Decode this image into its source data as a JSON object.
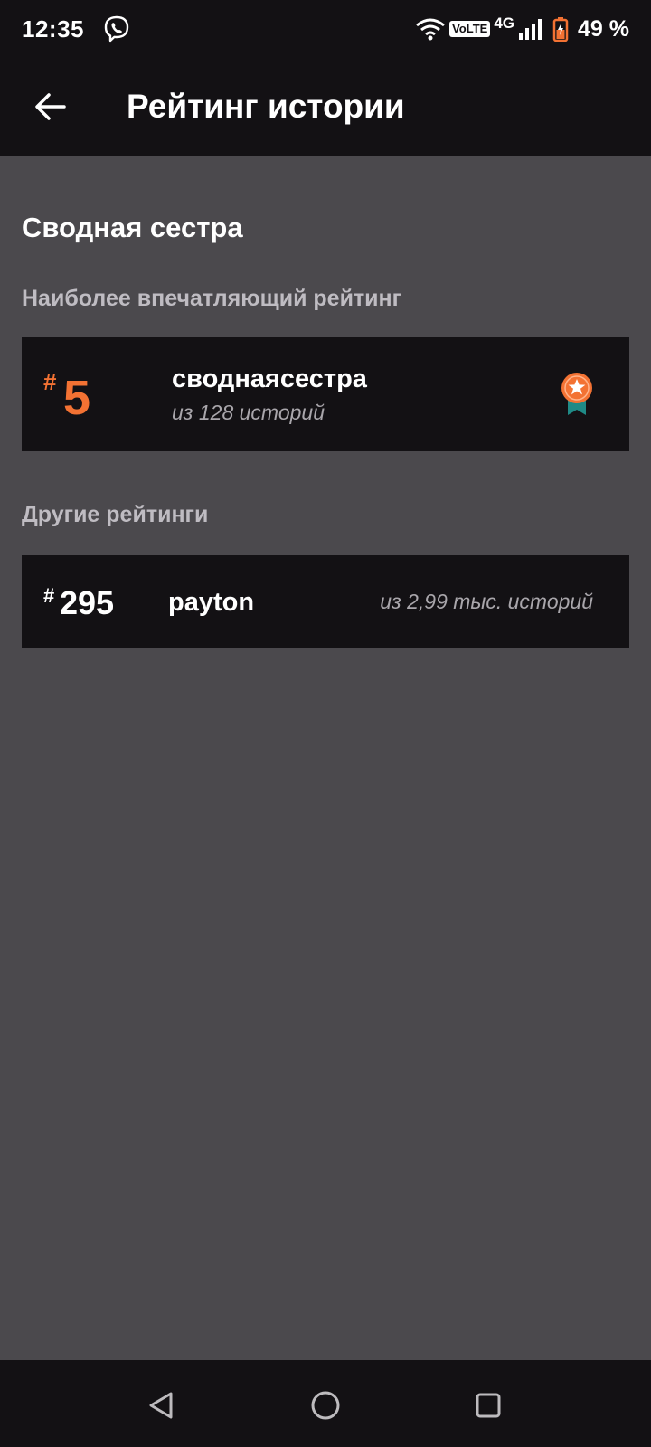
{
  "status_bar": {
    "time": "12:35",
    "volte": "VoLTE",
    "network": "4G",
    "battery": "49 %",
    "icons": [
      "viber-icon",
      "wifi-icon",
      "signal-icon",
      "battery-icon"
    ]
  },
  "app_bar": {
    "title": "Рейтинг истории",
    "back_icon": "arrow-left-icon"
  },
  "story": {
    "title": "Сводная сестра"
  },
  "top_section": {
    "label": "Наиболее впечатляющий рейтинг",
    "card": {
      "hash": "#",
      "rank": "5",
      "tag": "сводная­сестра",
      "count": "из 128 историй",
      "icon": "ribbon-star-icon"
    }
  },
  "other_section": {
    "label": "Другие рейтинги",
    "items": [
      {
        "hash": "#",
        "rank": "295",
        "tag": "payton",
        "count": "из 2,99 тыс. историй"
      }
    ]
  },
  "nav_bar": {
    "icons": [
      "nav-back-icon",
      "nav-home-icon",
      "nav-recents-icon"
    ]
  },
  "colors": {
    "accent": "#f37233",
    "background": "#4b494d",
    "bar": "#131114",
    "card": "#131114",
    "muted_text": "#a9a6ab",
    "ribbon_teal": "#1f8a86"
  }
}
